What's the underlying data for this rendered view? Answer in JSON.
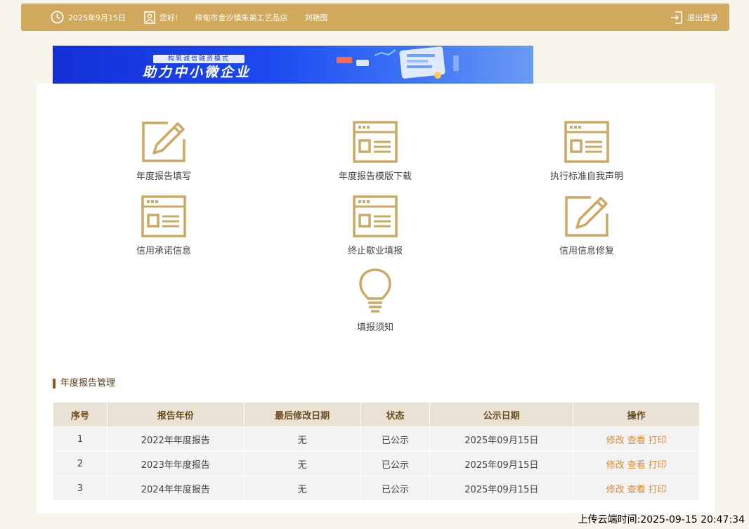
{
  "header": {
    "date": "2025年9月15日",
    "greeting": "您好!",
    "company": "梓甸市金沙镇朱弟工艺品店",
    "person": "刘艳囤",
    "logout_label": "退出登录"
  },
  "banner": {
    "subtitle": "构筑诚信融资模式",
    "title": "助力中小微企业"
  },
  "menu": [
    {
      "label": "年度报告填写",
      "icon": "edit-icon"
    },
    {
      "label": "年度报告模版下载",
      "icon": "document-icon"
    },
    {
      "label": "执行标准自我声明",
      "icon": "document-icon"
    },
    {
      "label": "信用承诺信息",
      "icon": "document-icon"
    },
    {
      "label": "终止歇业填报",
      "icon": "document-icon"
    },
    {
      "label": "信用信息修复",
      "icon": "edit-icon"
    },
    {
      "label": "填报须知",
      "icon": "lightbulb-icon"
    }
  ],
  "section_title": "年度报告管理",
  "table": {
    "headers": [
      "序号",
      "报告年份",
      "最后修改日期",
      "状态",
      "公示日期",
      "操作"
    ],
    "rows": [
      {
        "no": "1",
        "year": "2022年年度报告",
        "modified": "无",
        "status": "已公示",
        "pub_date": "2025年09月15日"
      },
      {
        "no": "2",
        "year": "2023年年度报告",
        "modified": "无",
        "status": "已公示",
        "pub_date": "2025年09月15日"
      },
      {
        "no": "3",
        "year": "2024年年度报告",
        "modified": "无",
        "status": "已公示",
        "pub_date": "2025年09月15日"
      }
    ],
    "actions": {
      "edit": "修改",
      "view": "查看",
      "print": "打印"
    }
  },
  "upload_time": "上传云端时间:2025-09-15 20:47:34",
  "colors": {
    "accent": "#d1a95e",
    "icon": "#cda863",
    "action": "#e08a2c"
  }
}
